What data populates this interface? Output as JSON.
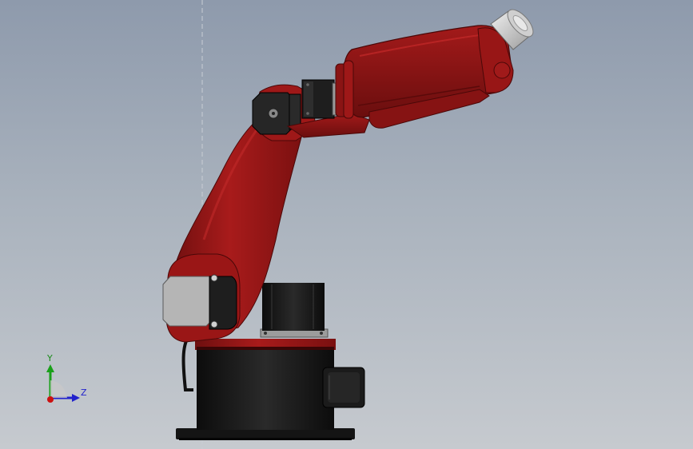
{
  "view": {
    "background_top": "#8e9aac",
    "background_bottom": "#c6cacf"
  },
  "model": {
    "arm_color": "#8f1515",
    "arm_highlight": "#b02020",
    "base_color": "#161616",
    "motor_color": "#1c1c1c",
    "cover_color": "#b4b4b4",
    "end_effector_color": "#d8d8d8"
  },
  "triad": {
    "y_label": "Y",
    "z_label": "Z",
    "y_color": "#1aa01a",
    "z_color": "#2222cc",
    "x_color": "#cc1111"
  }
}
